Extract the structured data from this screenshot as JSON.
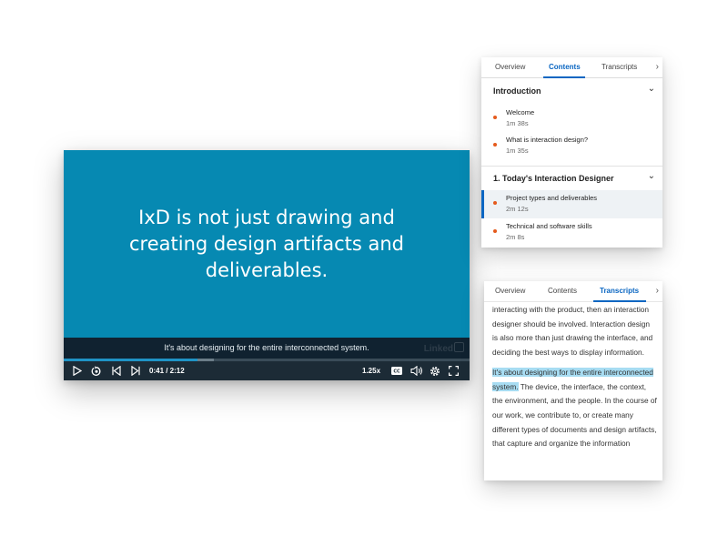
{
  "player": {
    "slide_text": "IxD is not just drawing and\ncreating design artifacts and\ndeliverables.",
    "caption": "It's about designing for the entire interconnected system.",
    "watermark": "Linked",
    "progress_fraction": 0.33,
    "buffer_fraction": 0.37,
    "time": "0:41 / 2:12",
    "speed": "1.25x",
    "icons": [
      "play-icon",
      "replay-icon",
      "previous-icon",
      "next-icon",
      "closed-captions-icon",
      "volume-icon",
      "settings-icon",
      "fullscreen-icon"
    ],
    "accent": "#0689b2"
  },
  "contents_panel": {
    "tabs": [
      {
        "label": "Overview",
        "active": false
      },
      {
        "label": "Contents",
        "active": true
      },
      {
        "label": "Transcripts",
        "active": false
      }
    ],
    "more": "›",
    "sections": [
      {
        "title": "Introduction",
        "items": [
          {
            "title": "Welcome",
            "duration": "1m 38s"
          },
          {
            "title": "What is interaction design?",
            "duration": "1m 35s"
          }
        ]
      },
      {
        "title": "1. Today's Interaction Designer",
        "items": [
          {
            "title": "Project types and deliverables",
            "duration": "2m 12s",
            "current": true
          },
          {
            "title": "Technical and software skills",
            "duration": "2m 8s"
          }
        ]
      }
    ]
  },
  "transcripts_panel": {
    "tabs": [
      {
        "label": "Overview",
        "active": false
      },
      {
        "label": "Contents",
        "active": false
      },
      {
        "label": "Transcripts",
        "active": true
      }
    ],
    "more": "›",
    "paragraph1": "interacting with the product, then an interaction designer should be involved. Interaction design is also more than just drawing the interface, and deciding the best ways to display information.",
    "highlighted": "It's about designing for the entire interconnected system.",
    "paragraph2_rest": " The device, the interface, the context, the environment, and the people. In the course of our work, we contribute to, or create many different types of documents and design artifacts, that capture and organize the information"
  }
}
